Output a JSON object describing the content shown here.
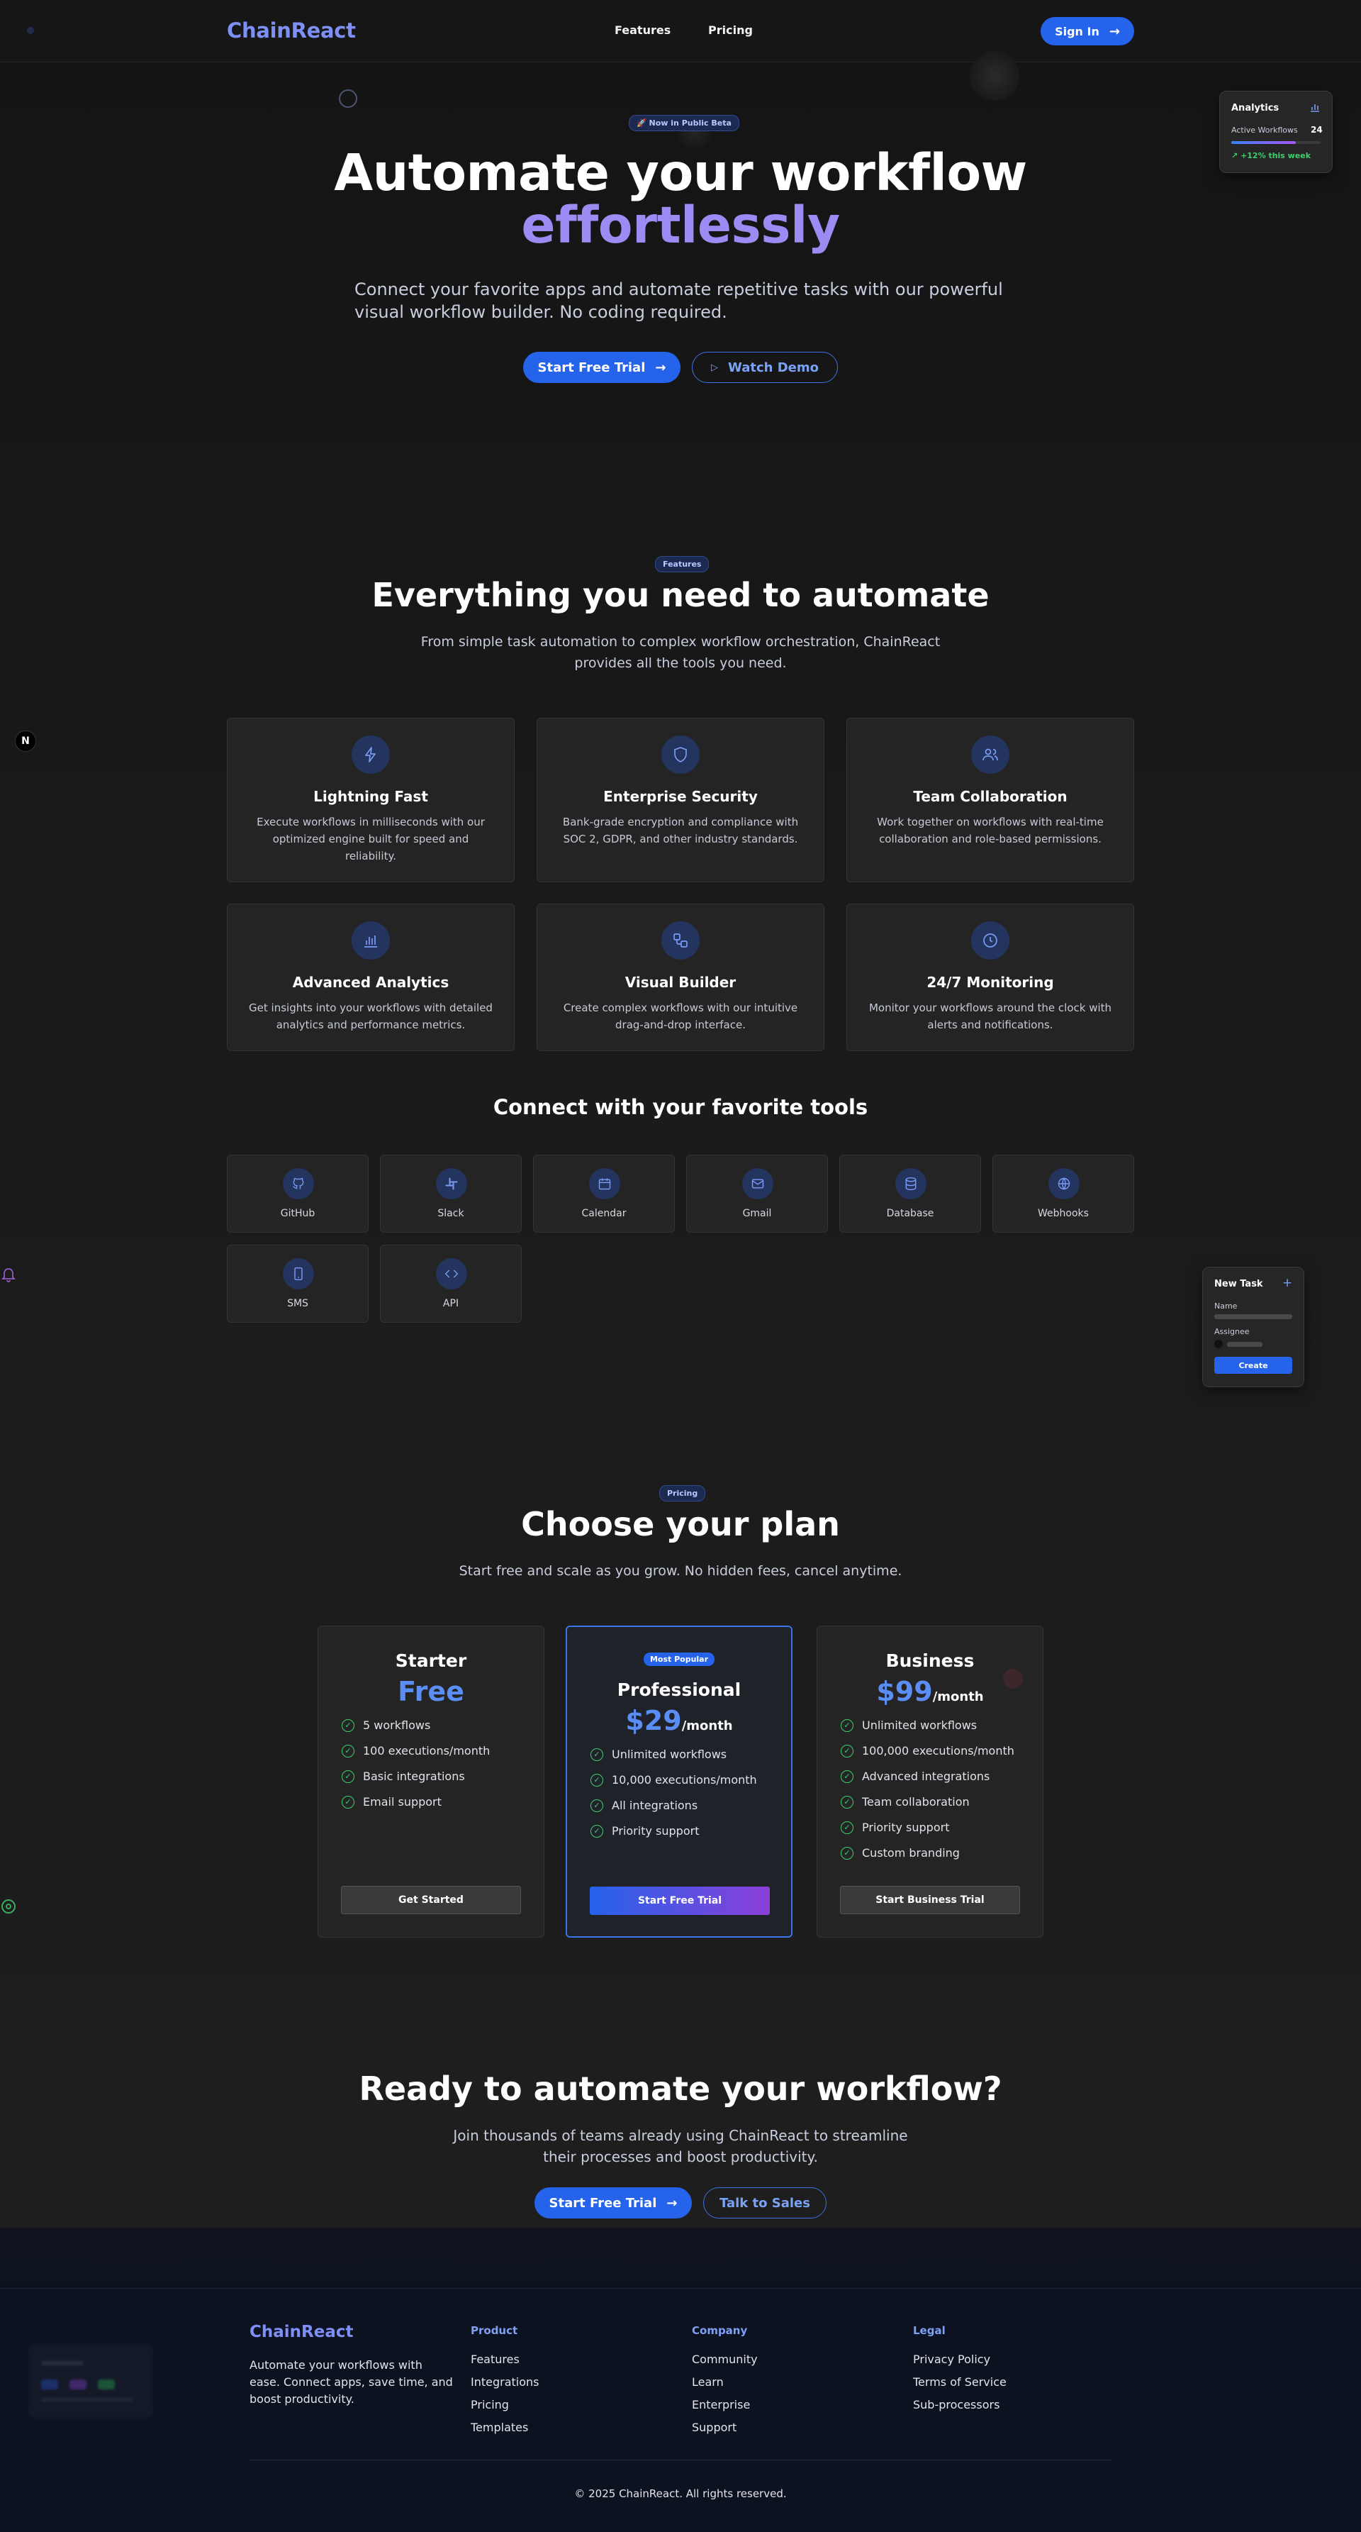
{
  "nav": {
    "logo": "ChainReact",
    "links": [
      "Features",
      "Pricing"
    ],
    "signin": "Sign In"
  },
  "hero": {
    "badge": "🚀 Now in Public Beta",
    "title_line1": "Automate your workflow",
    "title_line2": "effortlessly",
    "subtitle": "Connect your favorite apps and automate repetitive tasks with our powerful visual workflow builder. No coding required.",
    "cta_primary": "Start Free Trial",
    "cta_secondary": "Watch Demo"
  },
  "analytics_widget": {
    "title": "Analytics",
    "metric_label": "Active Workflows",
    "metric_value": "24",
    "trend": "+12% this week",
    "progress": 0.72
  },
  "task_widget": {
    "title": "New Task",
    "name_label": "Name",
    "assignee_label": "Assignee",
    "button": "Create"
  },
  "features": {
    "badge": "Features",
    "title": "Everything you need to automate",
    "subtitle": "From simple task automation to complex workflow orchestration, ChainReact provides all the tools you need.",
    "items": [
      {
        "icon": "lightning-icon",
        "title": "Lightning Fast",
        "desc": "Execute workflows in milliseconds with our optimized engine built for speed and reliability."
      },
      {
        "icon": "shield-icon",
        "title": "Enterprise Security",
        "desc": "Bank-grade encryption and compliance with SOC 2, GDPR, and other industry standards."
      },
      {
        "icon": "users-icon",
        "title": "Team Collaboration",
        "desc": "Work together on workflows with real-time collaboration and role-based permissions."
      },
      {
        "icon": "bar-chart-icon",
        "title": "Advanced Analytics",
        "desc": "Get insights into your workflows with detailed analytics and performance metrics."
      },
      {
        "icon": "workflow-icon",
        "title": "Visual Builder",
        "desc": "Create complex workflows with our intuitive drag-and-drop interface."
      },
      {
        "icon": "clock-icon",
        "title": "24/7 Monitoring",
        "desc": "Monitor your workflows around the clock with alerts and notifications."
      }
    ]
  },
  "tools": {
    "title": "Connect with your favorite tools",
    "items": [
      {
        "icon": "github-icon",
        "label": "GitHub"
      },
      {
        "icon": "slack-icon",
        "label": "Slack"
      },
      {
        "icon": "calendar-icon",
        "label": "Calendar"
      },
      {
        "icon": "mail-icon",
        "label": "Gmail"
      },
      {
        "icon": "database-icon",
        "label": "Database"
      },
      {
        "icon": "globe-icon",
        "label": "Webhooks"
      },
      {
        "icon": "phone-icon",
        "label": "SMS"
      },
      {
        "icon": "code-icon",
        "label": "API"
      }
    ]
  },
  "pricing": {
    "badge": "Pricing",
    "title": "Choose your plan",
    "subtitle": "Start free and scale as you grow. No hidden fees, cancel anytime.",
    "plans": [
      {
        "name": "Starter",
        "price": "Free",
        "period": "",
        "features": [
          "5 workflows",
          "100 executions/month",
          "Basic integrations",
          "Email support"
        ],
        "button": "Get Started"
      },
      {
        "name": "Professional",
        "badge": "Most Popular",
        "price": "$29",
        "period": "/month",
        "features": [
          "Unlimited workflows",
          "10,000 executions/month",
          "All integrations",
          "Priority support"
        ],
        "button": "Start Free Trial"
      },
      {
        "name": "Business",
        "price": "$99",
        "period": "/month",
        "features": [
          "Unlimited workflows",
          "100,000 executions/month",
          "Advanced integrations",
          "Team collaboration",
          "Priority support",
          "Custom branding"
        ],
        "button": "Start Business Trial"
      }
    ]
  },
  "cta": {
    "title": "Ready to automate your workflow?",
    "subtitle": "Join thousands of teams already using ChainReact to streamline their processes and boost productivity.",
    "primary": "Start Free Trial",
    "secondary": "Talk to Sales"
  },
  "footer": {
    "logo": "ChainReact",
    "tagline": "Automate your workflows with ease. Connect apps, save time, and boost productivity.",
    "columns": [
      {
        "heading": "Product",
        "links": [
          "Features",
          "Integrations",
          "Pricing",
          "Templates"
        ]
      },
      {
        "heading": "Company",
        "links": [
          "Community",
          "Learn",
          "Enterprise",
          "Support"
        ]
      },
      {
        "heading": "Legal",
        "links": [
          "Privacy Policy",
          "Terms of Service",
          "Sub-processors"
        ]
      }
    ],
    "copyright": "© 2025 ChainReact. All rights reserved."
  },
  "colors": {
    "accent": "#2563eb",
    "brand": "#7e8ff5",
    "gradient_text": "#9a8cf2",
    "success": "#3fcf6e",
    "background": "#161616"
  }
}
